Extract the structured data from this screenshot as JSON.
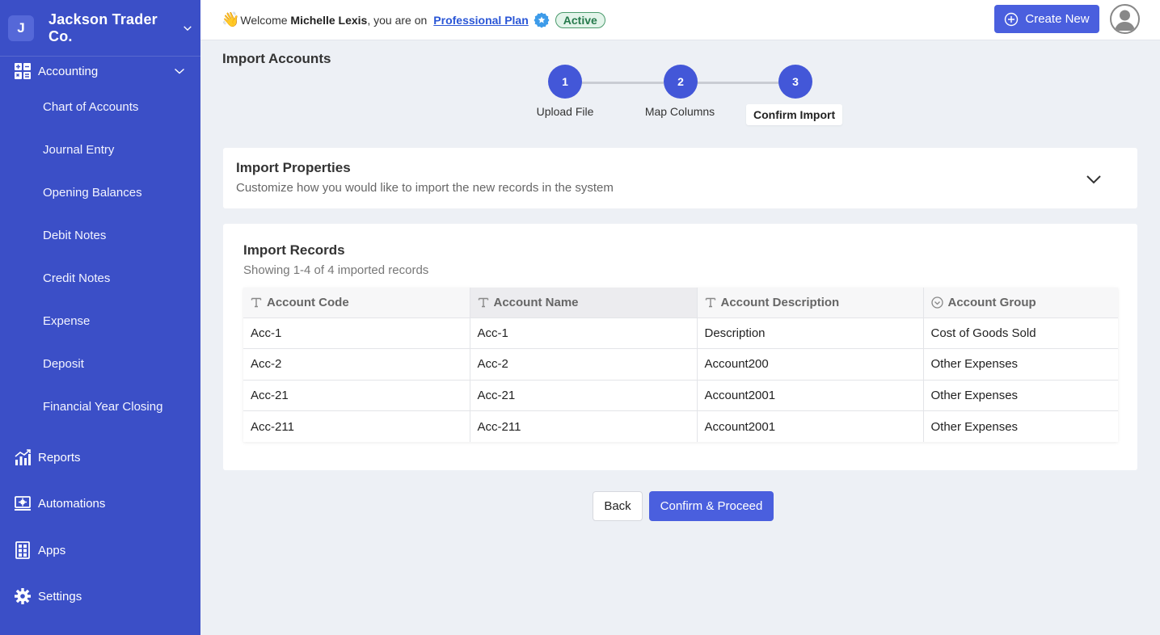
{
  "sidebar": {
    "company_initial": "J",
    "company_name": "Jackson Trader Co.",
    "accounting": {
      "label": "Accounting",
      "items": [
        {
          "label": "Chart of Accounts"
        },
        {
          "label": "Journal Entry"
        },
        {
          "label": "Opening Balances"
        },
        {
          "label": "Debit Notes"
        },
        {
          "label": "Credit Notes"
        },
        {
          "label": "Expense"
        },
        {
          "label": "Deposit"
        },
        {
          "label": "Financial Year Closing"
        }
      ]
    },
    "reports_label": "Reports",
    "automations_label": "Automations",
    "apps_label": "Apps",
    "settings_label": "Settings"
  },
  "header": {
    "welcome_prefix": "Welcome ",
    "user_name": "Michelle Lexis",
    "welcome_suffix": ", you are on",
    "plan_name": "Professional Plan",
    "status": "Active",
    "create_new_label": "Create New"
  },
  "page": {
    "title": "Import Accounts",
    "steps": [
      {
        "number": "1",
        "label": "Upload File"
      },
      {
        "number": "2",
        "label": "Map Columns"
      },
      {
        "number": "3",
        "label": "Confirm Import"
      }
    ]
  },
  "import_properties": {
    "title": "Import Properties",
    "subtitle": "Customize how you would like to import the new records in the system"
  },
  "import_records": {
    "title": "Import Records",
    "subtitle": "Showing 1-4 of 4 imported records",
    "columns": [
      "Account Code",
      "Account Name",
      "Account Description",
      "Account Group"
    ],
    "rows": [
      [
        "Acc-1",
        "Acc-1",
        "Description",
        "Cost of Goods Sold"
      ],
      [
        "Acc-2",
        "Acc-2",
        "Account200",
        "Other Expenses"
      ],
      [
        "Acc-21",
        "Acc-21",
        "Account2001",
        "Other Expenses"
      ],
      [
        "Acc-211",
        "Acc-211",
        "Account2001",
        "Other Expenses"
      ]
    ]
  },
  "actions": {
    "back_label": "Back",
    "confirm_label": "Confirm & Proceed"
  },
  "colors": {
    "sidebar": "#3b4fc7",
    "primary": "#4a5fde",
    "step": "#4357d8",
    "active_badge": "#267a4c"
  }
}
